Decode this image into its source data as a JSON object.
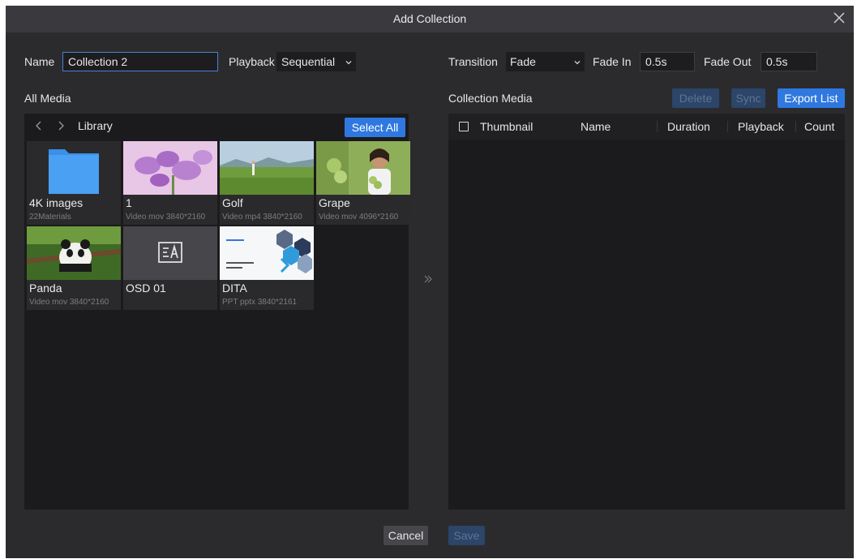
{
  "dialog": {
    "title": "Add Collection"
  },
  "form": {
    "name_label": "Name",
    "name_value": "Collection 2",
    "playback_label": "Playback",
    "playback_value": "Sequential",
    "transition_label": "Transition",
    "transition_value": "Fade",
    "fade_in_label": "Fade In",
    "fade_in_value": "0.5s",
    "fade_out_label": "Fade Out",
    "fade_out_value": "0.5s"
  },
  "all_media": {
    "heading": "All Media",
    "breadcrumb": "Library",
    "select_all_label": "Select All",
    "items": [
      {
        "name": "4K images",
        "sub": "22Materials",
        "icon": "folder-icon"
      },
      {
        "name": "1",
        "sub": "Video  mov  3840*2160",
        "icon": "flowers-thumbnail"
      },
      {
        "name": "Golf",
        "sub": "Video  mp4  3840*2160",
        "icon": "golf-thumbnail"
      },
      {
        "name": "Grape",
        "sub": "Video  mov  4096*2160",
        "icon": "grape-thumbnail"
      },
      {
        "name": "Panda",
        "sub": "Video  mov  3840*2160",
        "icon": "panda-thumbnail"
      },
      {
        "name": "OSD 01",
        "sub": "",
        "icon": "osd-text-icon"
      },
      {
        "name": "DITA",
        "sub": "PPT  pptx  3840*2161",
        "icon": "dita-slide-thumbnail"
      }
    ]
  },
  "collection_media": {
    "heading": "Collection Media",
    "delete_label": "Delete",
    "sync_label": "Sync",
    "export_label": "Export List",
    "columns": [
      "Thumbnail",
      "Name",
      "Duration",
      "Playback",
      "Count"
    ]
  },
  "footer": {
    "cancel_label": "Cancel",
    "save_label": "Save"
  },
  "colors": {
    "accent": "#2f78e0",
    "background": "#2b2b2e",
    "panel": "#1b1b1d"
  }
}
